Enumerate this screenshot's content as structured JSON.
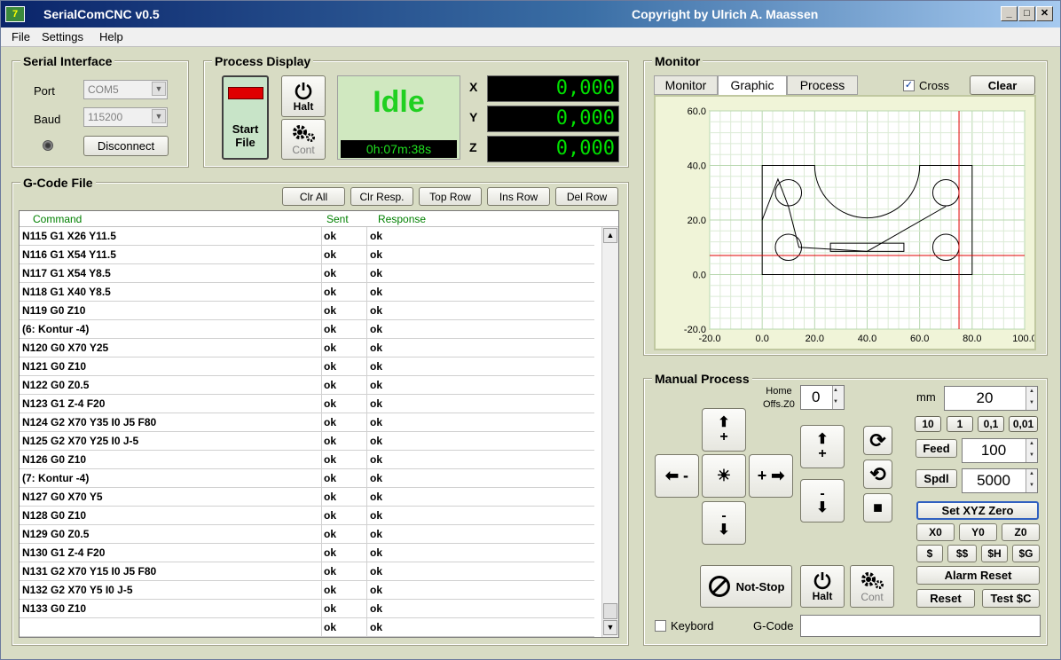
{
  "window": {
    "title": "SerialComCNC  v0.5",
    "copyright": "Copyright by Ulrich A. Maassen",
    "icon_text": "7"
  },
  "menu": {
    "file": "File",
    "settings": "Settings",
    "help": "Help"
  },
  "serial": {
    "title": "Serial Interface",
    "port_label": "Port",
    "port_value": "COM5",
    "baud_label": "Baud",
    "baud_value": "115200",
    "disconnect_label": "Disconnect"
  },
  "process_display": {
    "title": "Process Display",
    "start_label_1": "Start",
    "start_label_2": "File",
    "halt_label": "Halt",
    "cont_label": "Cont",
    "status": "Idle",
    "time": "0h:07m:38s",
    "x_label": "X",
    "x_value": "0,000",
    "y_label": "Y",
    "y_value": "0,000",
    "z_label": "Z",
    "z_value": "0,000"
  },
  "gcode": {
    "title": "G-Code File",
    "buttons": {
      "clr_all": "Clr All",
      "clr_resp": "Clr Resp.",
      "top_row": "Top Row",
      "ins_row": "Ins Row",
      "del_row": "Del Row"
    },
    "headers": {
      "command": "Command",
      "sent": "Sent",
      "response": "Response"
    },
    "rows": [
      {
        "command": "N115 G1 X26 Y11.5",
        "sent": "ok",
        "response": "ok"
      },
      {
        "command": "N116 G1 X54 Y11.5",
        "sent": "ok",
        "response": "ok"
      },
      {
        "command": "N117 G1 X54 Y8.5",
        "sent": "ok",
        "response": "ok"
      },
      {
        "command": "N118 G1 X40 Y8.5",
        "sent": "ok",
        "response": "ok"
      },
      {
        "command": "N119 G0 Z10",
        "sent": "ok",
        "response": "ok"
      },
      {
        "command": "(6: Kontur -4)",
        "sent": "ok",
        "response": "ok"
      },
      {
        "command": "N120 G0 X70 Y25",
        "sent": "ok",
        "response": "ok"
      },
      {
        "command": "N121 G0 Z10",
        "sent": "ok",
        "response": "ok"
      },
      {
        "command": "N122 G0 Z0.5",
        "sent": "ok",
        "response": "ok"
      },
      {
        "command": "N123 G1 Z-4 F20",
        "sent": "ok",
        "response": "ok"
      },
      {
        "command": "N124 G2 X70 Y35 I0 J5 F80",
        "sent": "ok",
        "response": "ok"
      },
      {
        "command": "N125 G2 X70 Y25 I0 J-5",
        "sent": "ok",
        "response": "ok"
      },
      {
        "command": "N126 G0 Z10",
        "sent": "ok",
        "response": "ok"
      },
      {
        "command": "(7: Kontur -4)",
        "sent": "ok",
        "response": "ok"
      },
      {
        "command": "N127 G0 X70 Y5",
        "sent": "ok",
        "response": "ok"
      },
      {
        "command": "N128 G0 Z10",
        "sent": "ok",
        "response": "ok"
      },
      {
        "command": "N129 G0 Z0.5",
        "sent": "ok",
        "response": "ok"
      },
      {
        "command": "N130 G1 Z-4 F20",
        "sent": "ok",
        "response": "ok"
      },
      {
        "command": "N131 G2 X70 Y15 I0 J5 F80",
        "sent": "ok",
        "response": "ok"
      },
      {
        "command": "N132 G2 X70 Y5 I0 J-5",
        "sent": "ok",
        "response": "ok"
      },
      {
        "command": "N133 G0 Z10",
        "sent": "ok",
        "response": "ok"
      },
      {
        "command": "",
        "sent": "ok",
        "response": "ok"
      }
    ]
  },
  "monitor": {
    "title": "Monitor",
    "tabs": [
      "Monitor",
      "Graphic",
      "Process"
    ],
    "active_tab": "Graphic",
    "cross_label": "Cross",
    "cross_checked": true,
    "clear_label": "Clear",
    "x_ticks": [
      "-20.0",
      "0.0",
      "20.0",
      "40.0",
      "60.0",
      "80.0",
      "100.0"
    ],
    "y_ticks": [
      "60.0",
      "40.0",
      "20.0",
      "0.0",
      "-20.0"
    ],
    "cross_x": 75,
    "cross_y": 7
  },
  "manual": {
    "title": "Manual Process",
    "home_label_1": "Home",
    "home_label_2": "Offs.Z0",
    "home_value": "0",
    "mm_label": "mm",
    "mm_value": "20",
    "steps": [
      "10",
      "1",
      "0,1",
      "0,01"
    ],
    "feed_label": "Feed",
    "feed_value": "100",
    "spdl_label": "Spdl",
    "spdl_value": "5000",
    "set_zero_label": "Set XYZ Zero",
    "x0_label": "X0",
    "y0_label": "Y0",
    "z0_label": "Z0",
    "cmd_buttons": [
      "$",
      "$$",
      "$H",
      "$G"
    ],
    "alarm_reset_label": "Alarm Reset",
    "reset_label": "Reset",
    "test_label": "Test $C",
    "notstop_label": "Not-Stop",
    "halt_label": "Halt",
    "cont_label": "Cont",
    "keyboard_label": "Keybord",
    "gcode_label": "G-Code",
    "gcode_value": ""
  }
}
